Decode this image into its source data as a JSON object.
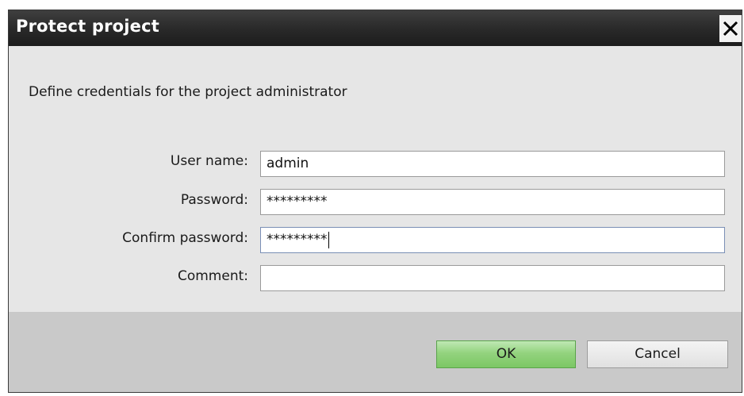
{
  "dialog": {
    "title": "Protect project",
    "close_icon": "close-icon",
    "instruction": "Define credentials for the project administrator"
  },
  "form": {
    "user_name": {
      "label": "User name:",
      "value": "admin"
    },
    "password": {
      "label": "Password:",
      "value": "*********"
    },
    "confirm_password": {
      "label": "Confirm password:",
      "value": "*********"
    },
    "comment": {
      "label": "Comment:",
      "value": ""
    }
  },
  "buttons": {
    "ok_label": "OK",
    "cancel_label": "Cancel"
  },
  "colors": {
    "title_bar": "#2a2a2a",
    "body": "#e6e6e6",
    "footer": "#c9c9c9",
    "ok_button": "#93d37e"
  }
}
